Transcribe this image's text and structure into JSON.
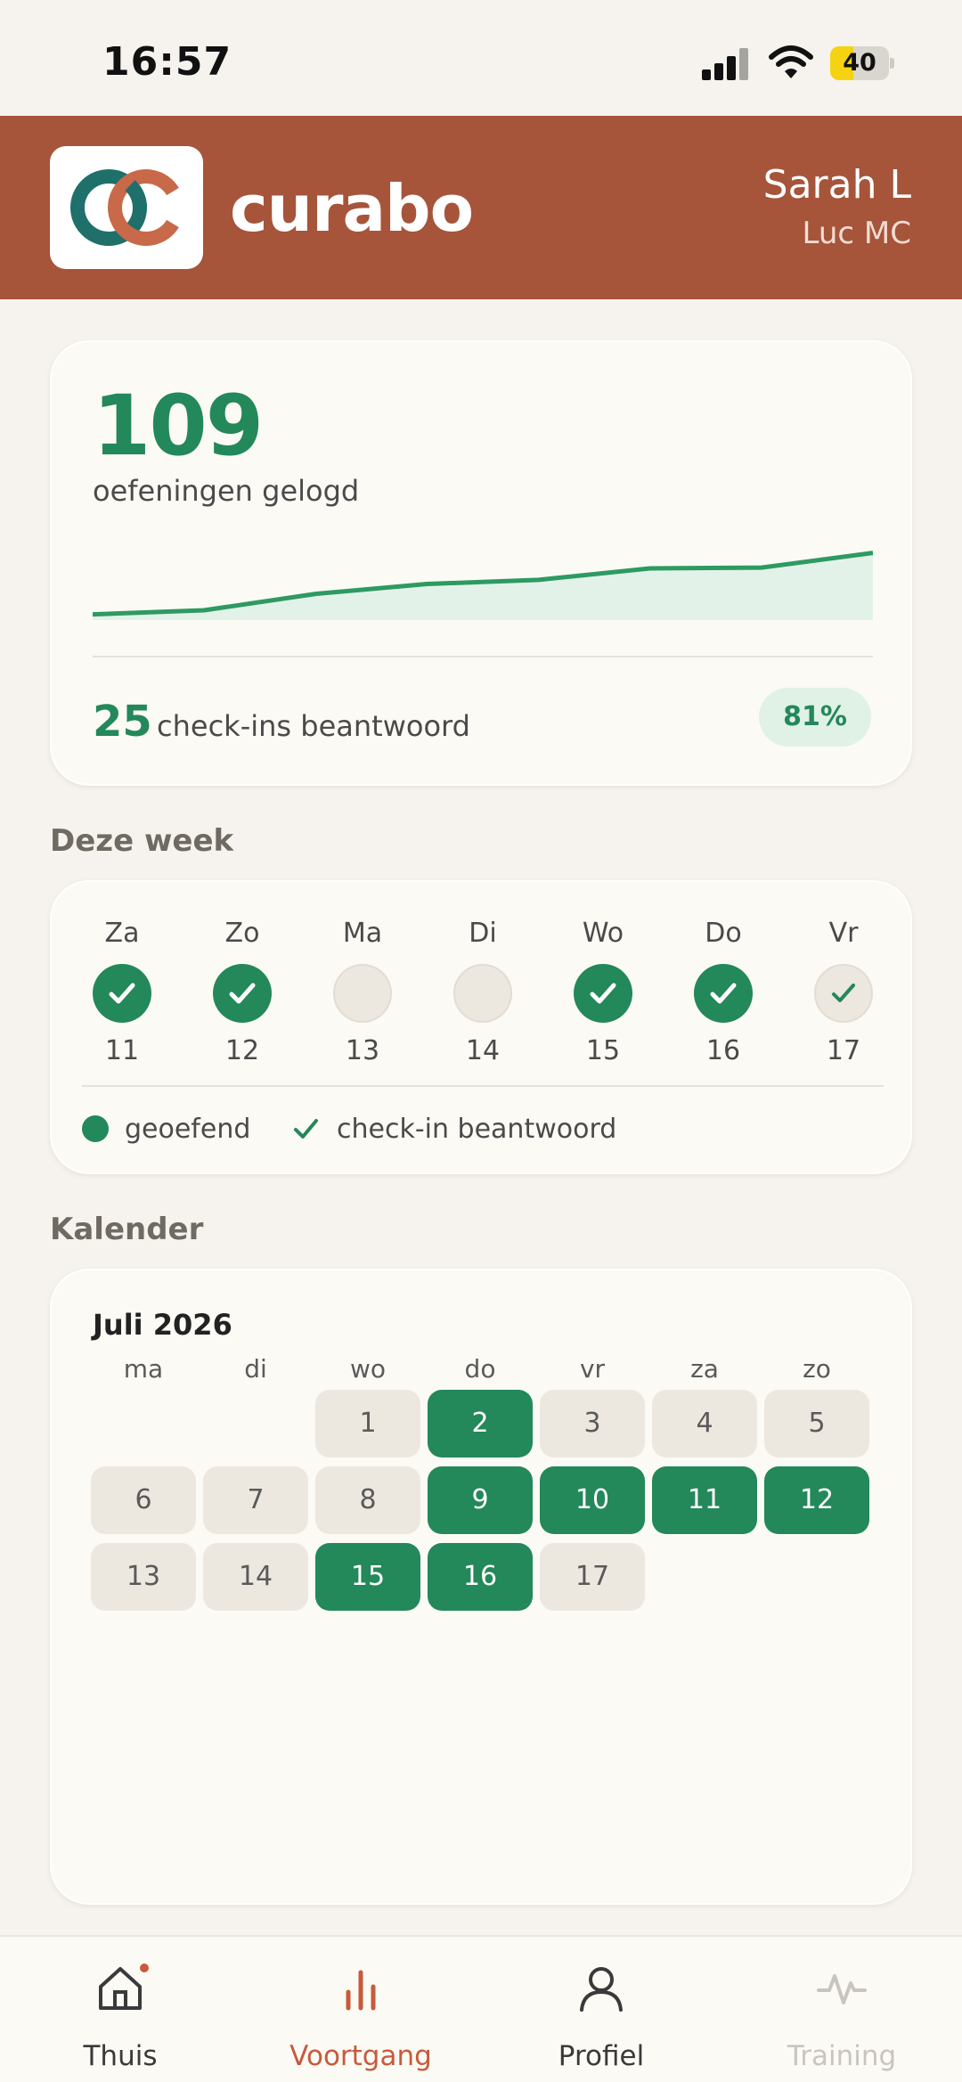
{
  "status_bar": {
    "time": "16:57",
    "battery": "40",
    "battery_level": 0.4,
    "icons": [
      "signal-icon",
      "wifi-icon",
      "battery-icon"
    ]
  },
  "header": {
    "app_name": "curabo",
    "user_name": "Sarah L",
    "user_org": "Luc MC",
    "color": "#a6543a"
  },
  "stats": {
    "exercises_count": "109",
    "exercises_label": "oefeningen gelogd",
    "checkins_count": "25",
    "checkins_label": "check-ins beantwoord",
    "checkins_percent": "81%",
    "trend": [
      7,
      12,
      32,
      44,
      49,
      63,
      64,
      82
    ]
  },
  "week": {
    "title": "Deze week",
    "days": [
      {
        "name": "Za",
        "num": "11",
        "state": "done"
      },
      {
        "name": "Zo",
        "num": "12",
        "state": "done"
      },
      {
        "name": "Ma",
        "num": "13",
        "state": "empty"
      },
      {
        "name": "Di",
        "num": "14",
        "state": "empty"
      },
      {
        "name": "Wo",
        "num": "15",
        "state": "done"
      },
      {
        "name": "Do",
        "num": "16",
        "state": "done"
      },
      {
        "name": "Vr",
        "num": "17",
        "state": "checkin"
      }
    ],
    "legend_practiced": "geoefend",
    "legend_checkin": "check-in beantwoord"
  },
  "calendar": {
    "title": "Kalender",
    "month": "Juli 2026",
    "weekdays": [
      "ma",
      "di",
      "wo",
      "do",
      "vr",
      "za",
      "zo"
    ],
    "first_weekday_index": 2,
    "days": [
      {
        "num": "1",
        "active": false
      },
      {
        "num": "2",
        "active": true
      },
      {
        "num": "3",
        "active": false
      },
      {
        "num": "4",
        "active": false
      },
      {
        "num": "5",
        "active": false
      },
      {
        "num": "6",
        "active": false
      },
      {
        "num": "7",
        "active": false
      },
      {
        "num": "8",
        "active": false
      },
      {
        "num": "9",
        "active": true
      },
      {
        "num": "10",
        "active": true
      },
      {
        "num": "11",
        "active": true
      },
      {
        "num": "12",
        "active": true
      },
      {
        "num": "13",
        "active": false
      },
      {
        "num": "14",
        "active": false
      },
      {
        "num": "15",
        "active": true
      },
      {
        "num": "16",
        "active": true
      },
      {
        "num": "17",
        "active": false
      }
    ]
  },
  "nav": {
    "items": [
      {
        "label": "Thuis",
        "icon": "home-icon",
        "state": "normal"
      },
      {
        "label": "Voortgang",
        "icon": "bar-chart-icon",
        "state": "active"
      },
      {
        "label": "Profiel",
        "icon": "user-icon",
        "state": "normal"
      },
      {
        "label": "Training",
        "icon": "activity-icon",
        "state": "disabled"
      }
    ],
    "colors": {
      "normal": "#3a3a3a",
      "active": "#c85a3c",
      "disabled": "#c9c5be"
    }
  },
  "colors": {
    "accent_green": "#23885a",
    "header_brown": "#a6543a",
    "light_green": "#e0f1e6"
  }
}
